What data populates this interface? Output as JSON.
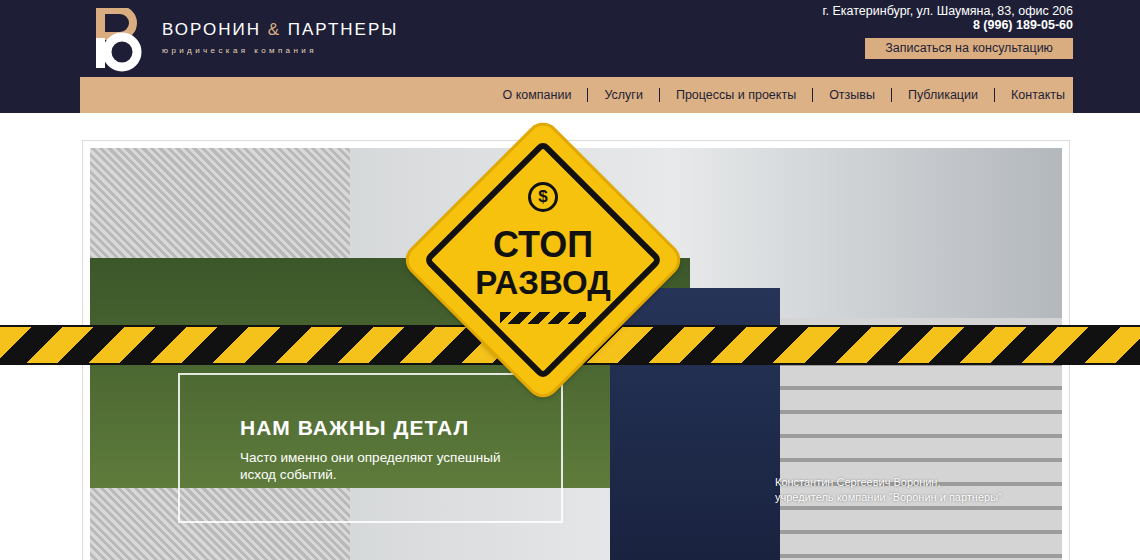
{
  "header": {
    "logo_name_start": "ВОРОНИН",
    "logo_amp": "&",
    "logo_name_end": "ПАРТНЕРЫ",
    "logo_tagline": "юридическая компания",
    "address": "г. Екатеринбург, ул. Шаумяна, 83, офис 206",
    "phone": "8 (996) 189-05-60",
    "cta": "Записаться на консультацию"
  },
  "nav": [
    {
      "label": "О компании"
    },
    {
      "label": "Услуги"
    },
    {
      "label": "Процессы и проекты"
    },
    {
      "label": "Отзывы"
    },
    {
      "label": "Публикации"
    },
    {
      "label": "Контакты"
    }
  ],
  "hero": {
    "title": "НАМ ВАЖНЫ ДЕТАЛ",
    "subtitle_lines": [
      "Часто именно они определяют успешный",
      "исход событий."
    ],
    "caption_lines": [
      "Константин Сергеевич Воронин,",
      "учредитель компании \"Воронин и партнеры\""
    ]
  },
  "sign": {
    "glyph": "$",
    "line1": "СТОП",
    "line2": "РАЗВОД"
  }
}
